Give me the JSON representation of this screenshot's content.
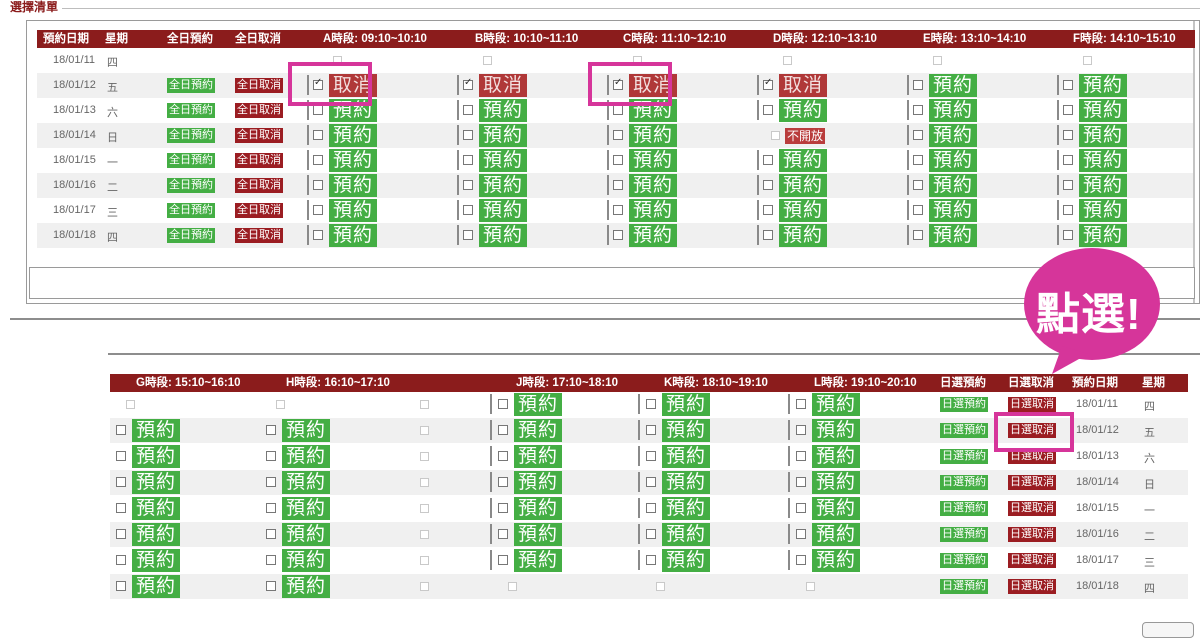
{
  "legend": "選擇清單",
  "top": {
    "headers": {
      "date": "預約日期",
      "week": "星期",
      "all_reserve": "全日預約",
      "all_cancel": "全日取消",
      "slots": [
        "A時段: 09:10~10:10",
        "B時段: 10:10~11:10",
        "C時段: 11:10~12:10",
        "D時段: 12:10~13:10",
        "E時段: 13:10~14:10",
        "F時段: 14:10~15:10"
      ]
    },
    "rows": [
      {
        "date": "18/01/11",
        "week": "四"
      },
      {
        "date": "18/01/12",
        "week": "五"
      },
      {
        "date": "18/01/13",
        "week": "六"
      },
      {
        "date": "18/01/14",
        "week": "日"
      },
      {
        "date": "18/01/15",
        "week": "一"
      },
      {
        "date": "18/01/16",
        "week": "二"
      },
      {
        "date": "18/01/17",
        "week": "三"
      },
      {
        "date": "18/01/18",
        "week": "四"
      }
    ]
  },
  "bottom": {
    "headers": {
      "slots": [
        "G時段: 15:10~16:10",
        "H時段: 16:10~17:10",
        "J時段: 17:10~18:10",
        "K時段: 18:10~19:10",
        "L時段: 19:10~20:10"
      ],
      "day_reserve": "日選預約",
      "day_cancel": "日選取消",
      "date": "預約日期",
      "week": "星期"
    }
  },
  "labels": {
    "btn_all_reserve": "全日預約",
    "btn_all_cancel": "全日取消",
    "btn_day_reserve": "日選預約",
    "btn_day_cancel": "日選取消",
    "reserve": "預約",
    "cancel": "取消",
    "not_open": "不開放"
  },
  "callout": "點選!",
  "colors": {
    "header": "#8b1c1c",
    "reserve": "#44ae44",
    "cancel": "#9b1d22",
    "highlight": "#d6359a"
  }
}
